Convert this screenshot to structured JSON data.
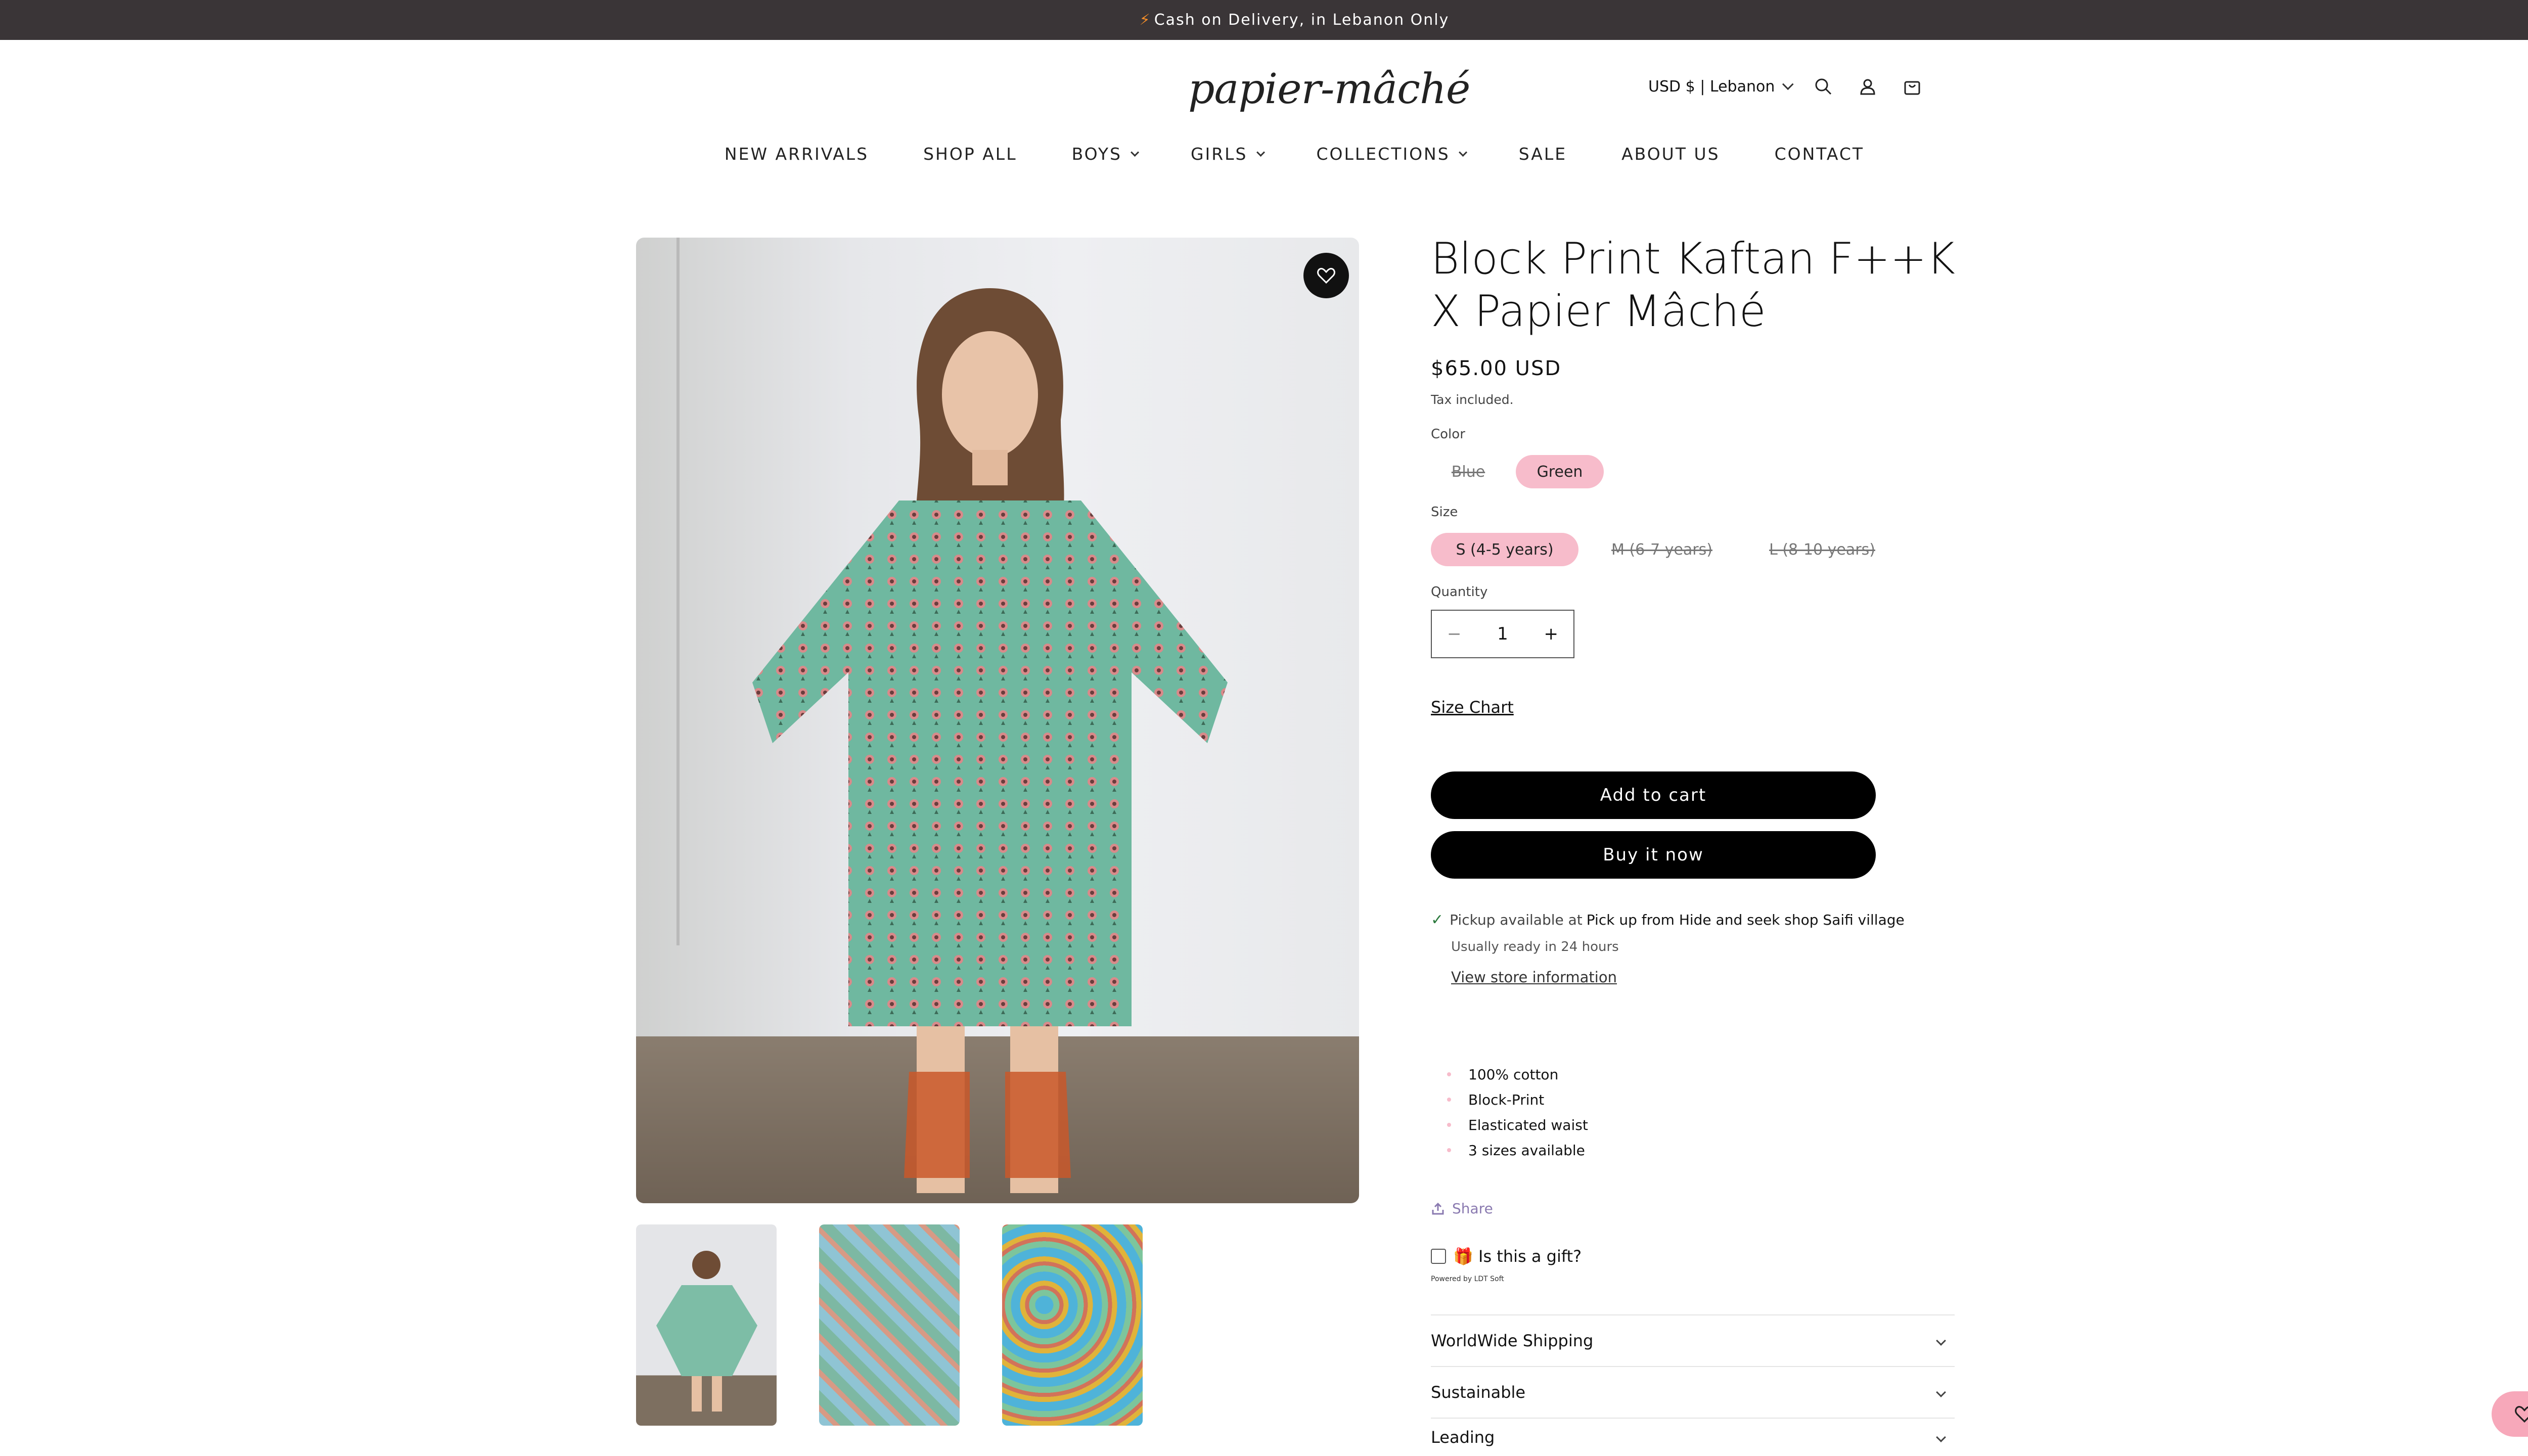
{
  "announcement": {
    "bolt": "⚡",
    "text": "Cash on Delivery, in Lebanon Only"
  },
  "header": {
    "logo": "papier-mâché",
    "locale": "USD $ | Lebanon",
    "icons": [
      "search-icon",
      "account-icon",
      "cart-icon"
    ]
  },
  "nav": {
    "items": [
      {
        "label": "NEW ARRIVALS"
      },
      {
        "label": "SHOP ALL"
      },
      {
        "label": "BOYS"
      },
      {
        "label": "GIRLS"
      },
      {
        "label": "COLLECTIONS"
      },
      {
        "label": "SALE"
      },
      {
        "label": "ABOUT US"
      },
      {
        "label": "CONTACT"
      }
    ]
  },
  "product": {
    "title": "Block Print Kaftan F++K X Papier Mâché",
    "price": "$65.00 USD",
    "tax": "Tax included.",
    "color_label": "Color",
    "colors": [
      "Blue",
      "Green"
    ],
    "selected_color": "Green",
    "size_label": "Size",
    "sizes": [
      "S (4-5 years)",
      "M (6-7 years)",
      "L (8-10 years)"
    ],
    "selected_size": "S (4-5 years)",
    "quantity_label": "Quantity",
    "quantity": "1",
    "minus": "−",
    "plus": "+",
    "size_chart": "Size Chart",
    "add_to_cart": "Add to cart",
    "buy_now": "Buy it now",
    "pickup_prefix": "Pickup available at",
    "pickup_location": "Pick up from Hide and seek shop Saifi village",
    "ready": "Usually ready in 24 hours",
    "store_info": "View store information",
    "features": [
      "100% cotton",
      "Block-Print",
      "Elasticated waist",
      "3 sizes available"
    ],
    "share": "Share",
    "gift": "🎁 Is this a gift?",
    "powered": "Powered by LDT Soft",
    "accordions": [
      "WorldWide Shipping",
      "Sustainable",
      "Leading"
    ]
  },
  "colors": {
    "accent_pink": "#f7bccb",
    "announcement_bg": "#3a3537",
    "button_bg": "#000000"
  }
}
